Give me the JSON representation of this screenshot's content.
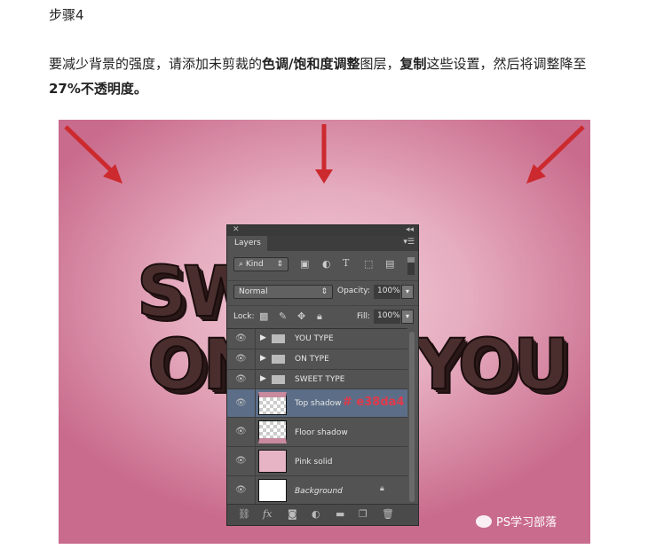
{
  "step_title": "步骤4",
  "paragraph": {
    "parts": [
      "要减少背景的强度，请添加未剪裁的",
      "色调/饱和度调整",
      "图层，",
      "复制",
      "这些设置，然后将调整降至",
      "27%不透明度。"
    ]
  },
  "image": {
    "background_text": [
      "SWEET",
      "ON",
      "YOU"
    ],
    "panel": {
      "tab": "Layers",
      "filter_kind": "Kind",
      "blend_mode": "Normal",
      "opacity_label": "Opacity:",
      "opacity_value": "100%",
      "lock_label": "Lock:",
      "fill_label": "Fill:",
      "fill_value": "100%",
      "layers": [
        {
          "name": "YOU TYPE",
          "type": "group"
        },
        {
          "name": "ON TYPE",
          "type": "group"
        },
        {
          "name": "SWEET TYPE",
          "type": "group"
        },
        {
          "name": "Top shadow",
          "type": "layer",
          "selected": true
        },
        {
          "name": "Floor shadow",
          "type": "layer"
        },
        {
          "name": "Pink solid",
          "type": "layer"
        },
        {
          "name": "Background",
          "type": "layer",
          "locked": true
        }
      ],
      "color_annotation": "# e38da4"
    },
    "watermark": "PS学习部落",
    "arrow_color": "#cc2a2e",
    "pink_color": "#e38da4"
  }
}
